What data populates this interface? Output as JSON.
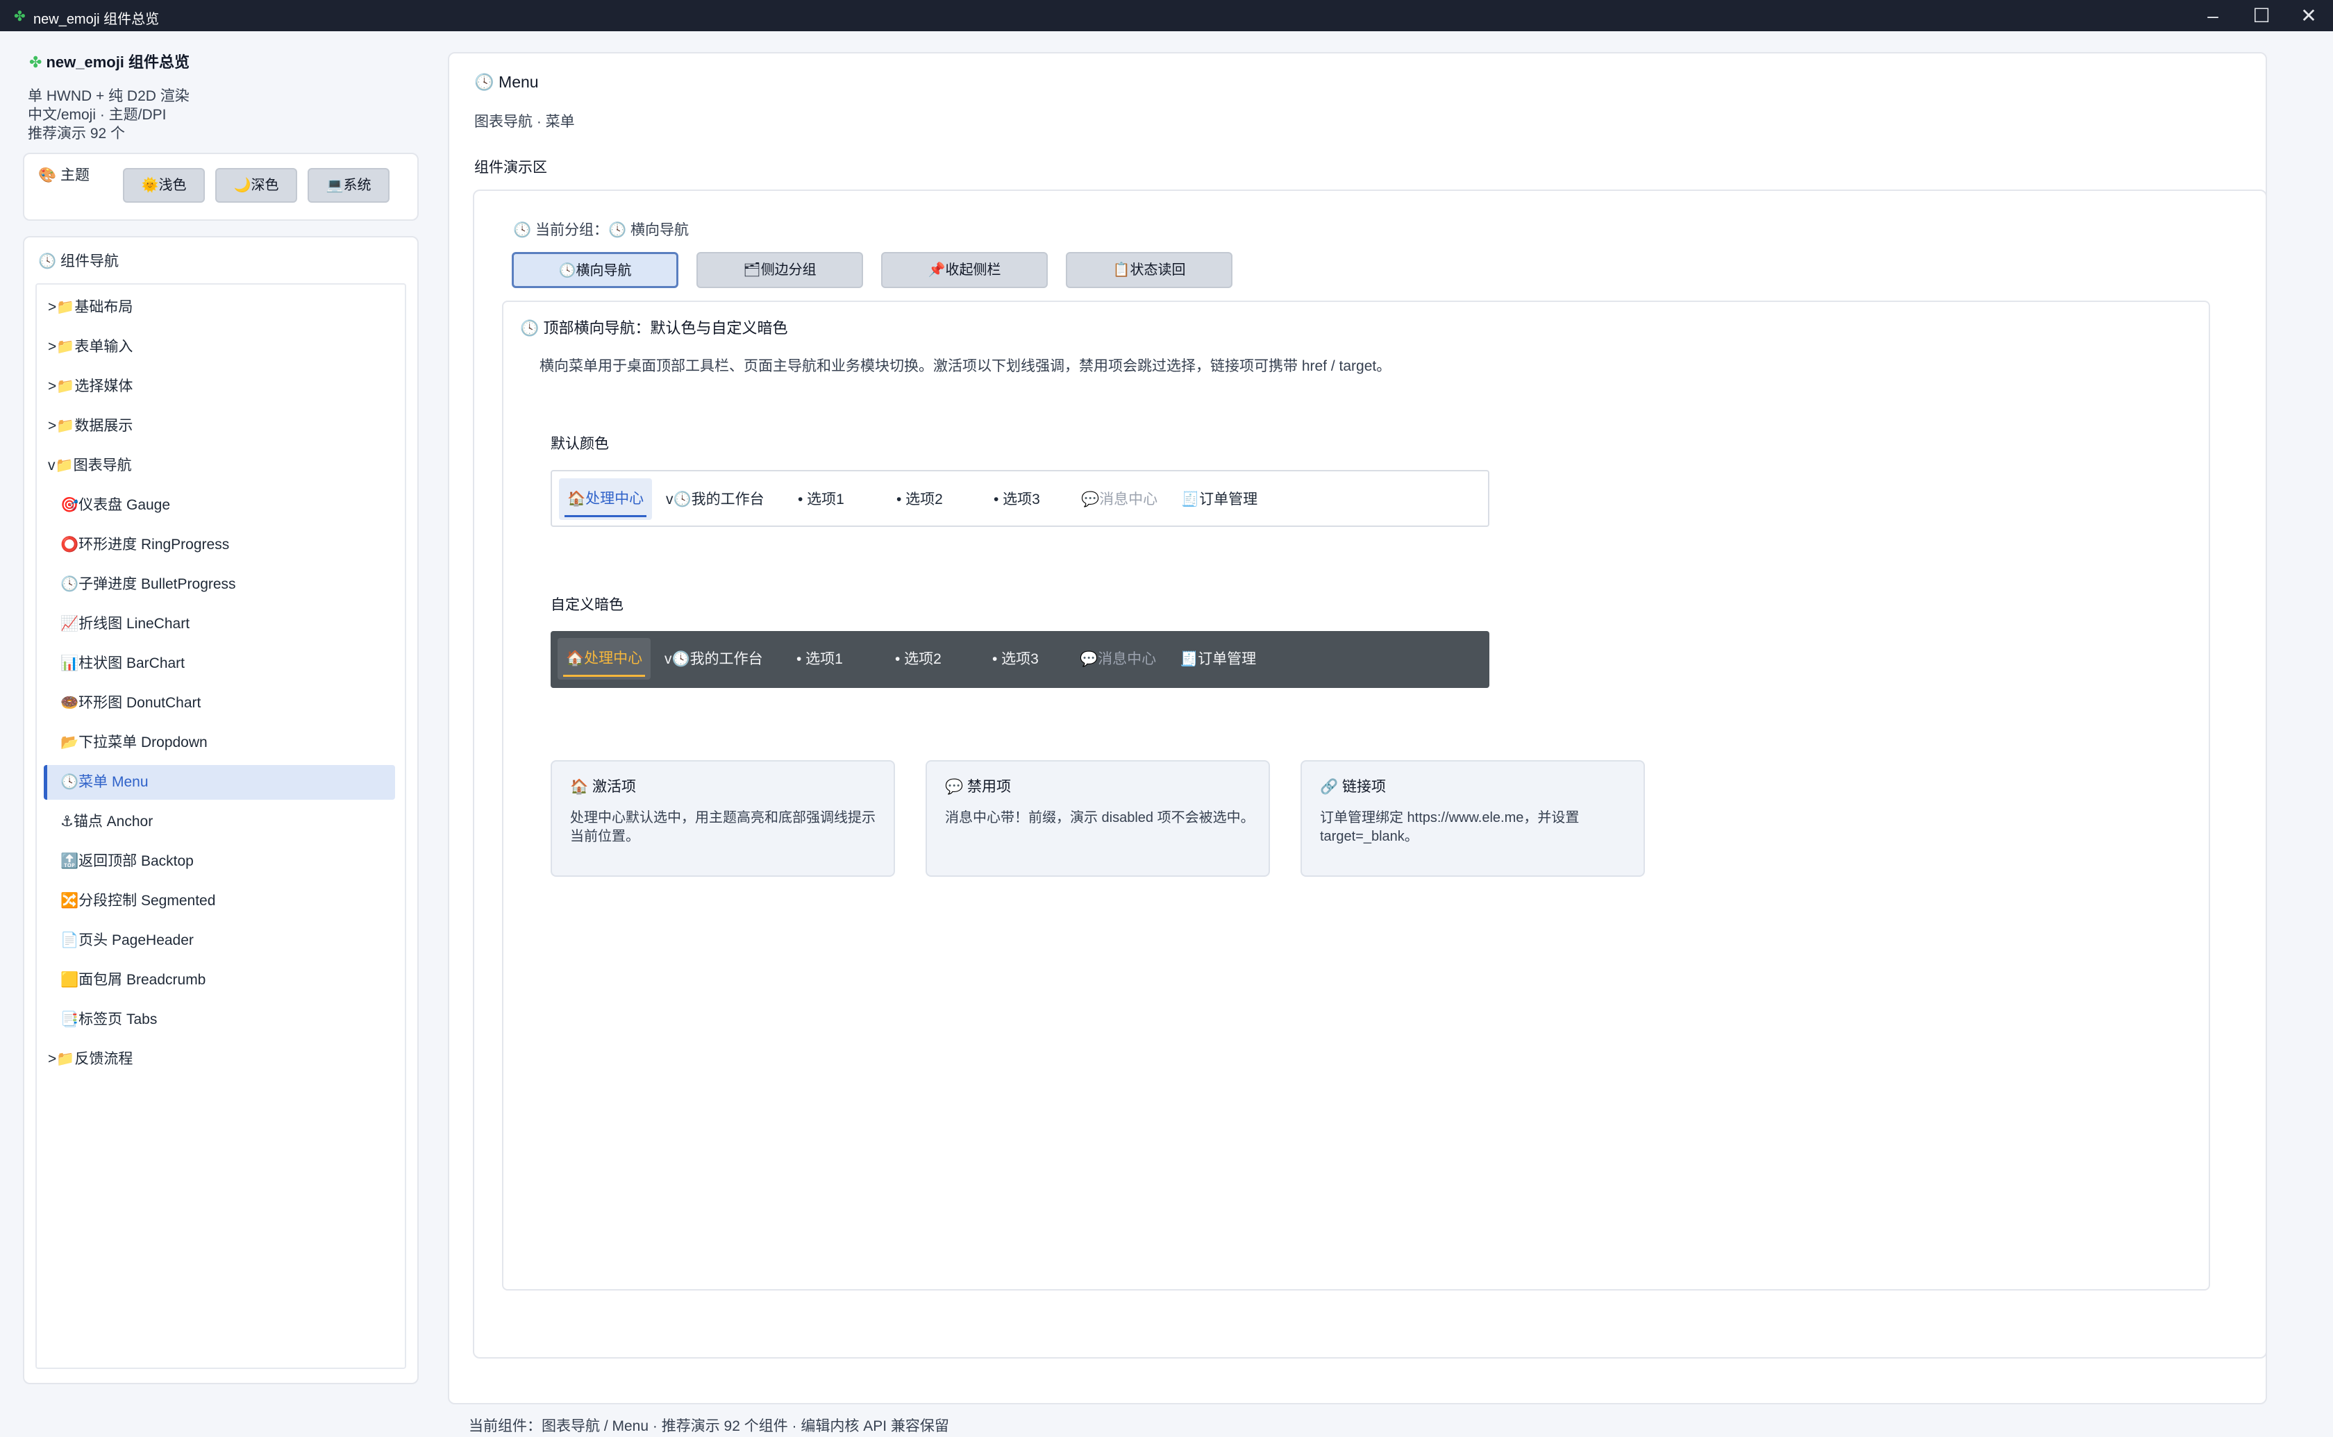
{
  "window": {
    "title": "new_emoji 组件总览",
    "icon": "clover-icon"
  },
  "sidebar": {
    "app_title": "new_emoji 组件总览",
    "desc": [
      "单 HWND + 纯 D2D 渲染",
      "中文/emoji · 主题/DPI",
      "推荐演示 92 个"
    ],
    "theme": {
      "label": "主题",
      "buttons": [
        "🌞浅色",
        "🌙深色",
        "💻系统"
      ]
    },
    "nav": {
      "label": "组件导航",
      "items": [
        ">📁基础布局",
        ">📁表单输入",
        ">📁选择媒体",
        ">📁数据展示",
        "v📁图表导航",
        "🎯仪表盘 Gauge",
        "⭕环形进度 RingProgress",
        "🕓子弹进度 BulletProgress",
        "📈折线图 LineChart",
        "📊柱状图 BarChart",
        "🍩环形图 DonutChart",
        "📂下拉菜单 Dropdown",
        "🕓菜单 Menu",
        "⚓锚点 Anchor",
        "🔝返回顶部 Backtop",
        "🔀分段控制 Segmented",
        "📄页头 PageHeader",
        "🟨面包屑 Breadcrumb",
        "📑标签页 Tabs",
        ">📁反馈流程"
      ]
    }
  },
  "main": {
    "title": "Menu",
    "subtitle": "图表导航 · 菜单",
    "demo_label": "组件演示区",
    "group_line": "当前分组：🕓 横向导航",
    "tabs": [
      "🕓横向导航",
      "🗂侧边分组",
      "📌收起侧栏",
      "📋状态读回"
    ],
    "section": {
      "title": "顶部横向导航：默认色与自定义暗色",
      "desc": "横向菜单用于桌面顶部工具栏、页面主导航和业务模块切换。激活项以下划线强调，禁用项会跳过选择，链接项可携带 href / target。",
      "default_label": "默认颜色",
      "dark_label": "自定义暗色",
      "menu_items": [
        "🏠处理中心",
        "v🕓我的工作台",
        "• 选项1",
        "• 选项2",
        "• 选项3",
        "💬消息中心",
        "🧾订单管理"
      ]
    },
    "cards": [
      {
        "title": "激活项",
        "icon": "home-icon",
        "desc": "处理中心默认选中，用主题高亮和底部强调线提示当前位置。"
      },
      {
        "title": "禁用项",
        "icon": "chat-icon",
        "desc": "消息中心带！前缀，演示 disabled 项不会被选中。"
      },
      {
        "title": "链接项",
        "icon": "link-icon",
        "desc": "订单管理绑定 https://www.ele.me，并设置 target=_blank。"
      }
    ]
  },
  "status": "当前组件：图表导航 / Menu · 推荐演示 92 个组件 · 编辑内核 API 兼容保留",
  "colors": {
    "accent": "#2f62c9",
    "dark_accent": "#f6b73c",
    "dark_bar": "#4b5258"
  }
}
